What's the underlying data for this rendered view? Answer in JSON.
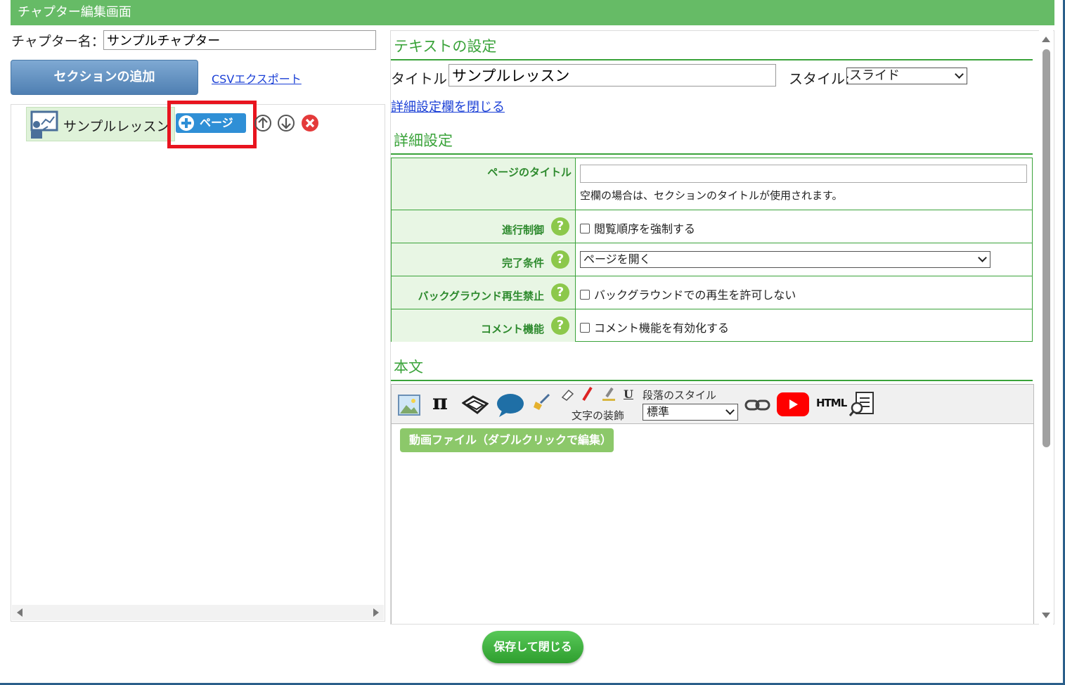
{
  "window": {
    "title": "チャプター編集画面"
  },
  "left": {
    "chapter_label": "チャプター名：",
    "chapter_name": "サンプルチャプター",
    "add_section_label": "セクションの追加",
    "csv_export_label": "CSVエクスポート",
    "tree": [
      {
        "label": "サンプルレッスン",
        "add_page_label": "ページ"
      }
    ]
  },
  "right": {
    "text_settings_heading": "テキストの設定",
    "title_label": "タイトル:",
    "title_value": "サンプルレッスン",
    "style_label": "スタイル:",
    "style_value": "スライド",
    "collapse_details_label": "詳細設定欄を閉じる",
    "details_heading": "詳細設定",
    "details": {
      "page_title_label": "ページのタイトル",
      "page_title_value": "",
      "page_title_hint": "空欄の場合は、セクションのタイトルが使用されます。",
      "progress_label": "進行制御",
      "progress_option": "閲覧順序を強制する",
      "completion_label": "完了条件",
      "completion_value": "ページを開く",
      "background_label": "バックグラウンド再生禁止",
      "background_option": "バックグラウンドでの再生を許可しない",
      "comment_label": "コメント機能",
      "comment_option": "コメント機能を有効化する",
      "help_glyph": "?"
    },
    "body_heading": "本文",
    "toolbar": {
      "paragraph_style_label": "段落のスタイル",
      "paragraph_style_value": "標準",
      "text_decoration_label": "文字の装飾",
      "pi_glyph": "π",
      "underline_glyph": "U",
      "html_label": "HTML"
    },
    "video_file_label": "動画ファイル（ダブルクリックで編集）"
  },
  "footer": {
    "save_close_label": "保存して閉じる"
  },
  "colors": {
    "accent_green": "#3aa33a",
    "titlebar": "#66bb66",
    "highlight_red": "#e8141f",
    "page_button_blue": "#2f8fd6"
  }
}
